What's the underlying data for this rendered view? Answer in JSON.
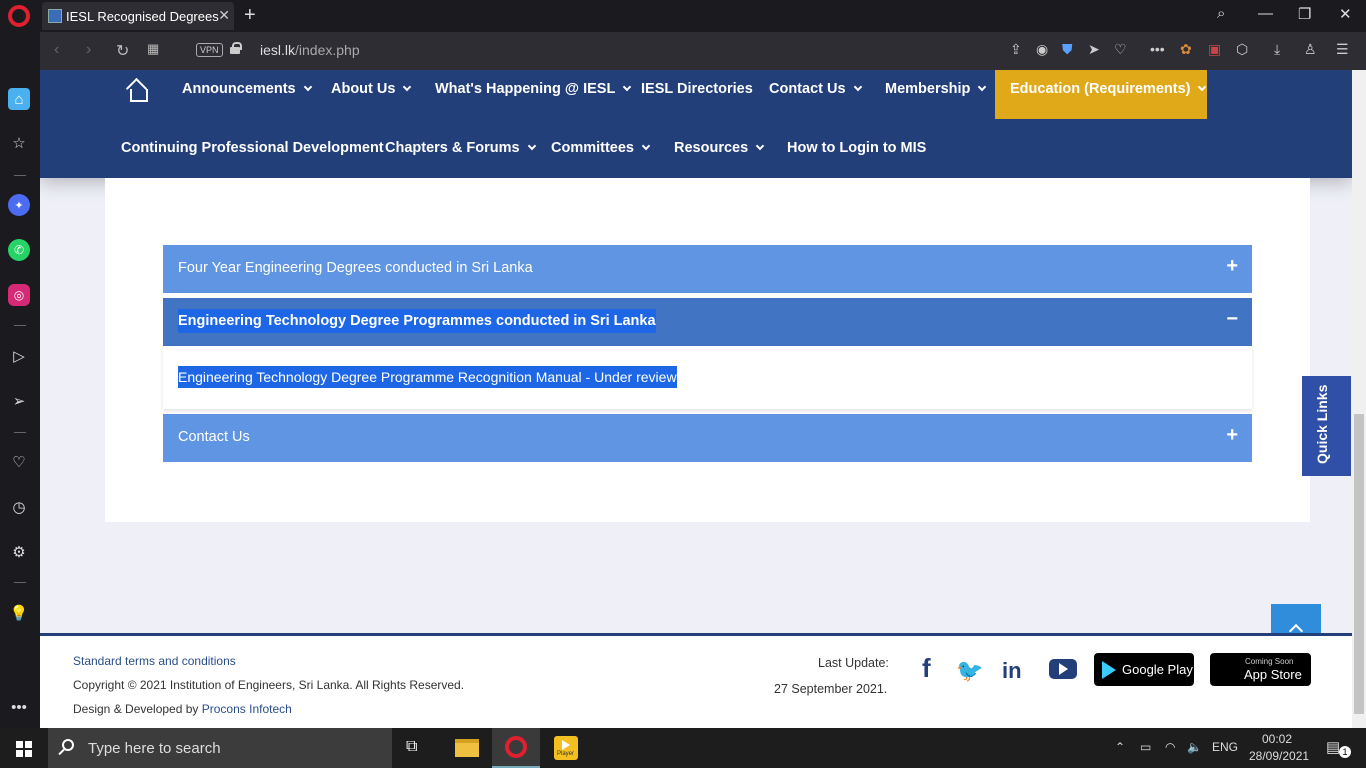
{
  "browser": {
    "tab_title": "IESL Recognised Degrees",
    "url_domain": "iesl.lk",
    "url_path": "/index.php",
    "vpn_label": "VPN"
  },
  "nav": {
    "row1": [
      {
        "label": "Announcements",
        "dropdown": true
      },
      {
        "label": "About Us",
        "dropdown": true
      },
      {
        "label": "What's Happening @ IESL",
        "dropdown": true
      },
      {
        "label": "IESL Directories",
        "dropdown": false
      },
      {
        "label": "Contact Us",
        "dropdown": true
      },
      {
        "label": "Membership",
        "dropdown": true
      },
      {
        "label": "Education (Requirements)",
        "dropdown": true,
        "active": true
      }
    ],
    "row2": [
      {
        "label": "Continuing Professional Development",
        "dropdown": false
      },
      {
        "label": "Chapters & Forums",
        "dropdown": true
      },
      {
        "label": "Committees",
        "dropdown": true
      },
      {
        "label": "Resources",
        "dropdown": true
      },
      {
        "label": "How to Login to MIS",
        "dropdown": false
      }
    ]
  },
  "accordion": [
    {
      "label": "Four Year Engineering Degrees conducted in Sri Lanka",
      "sign": "+",
      "expanded": false
    },
    {
      "label": "Engineering Technology Degree Programmes conducted in Sri Lanka",
      "sign": "−",
      "expanded": true,
      "body_link": "Engineering Technology Degree Programme Recognition Manual - Under review"
    },
    {
      "label": "Contact Us",
      "sign": "+",
      "expanded": false
    }
  ],
  "quick_links": "Quick Links",
  "footer": {
    "terms": "Standard terms and conditions",
    "copyright": "Copyright © 2021 Institution of Engineers, Sri Lanka. All Rights Reserved.",
    "design_prefix": "Design & Developed by ",
    "design_link": "Procons Infotech",
    "last_update_label": "Last Update:",
    "last_update_date": "27 September 2021.",
    "google_play": "Google Play",
    "app_store_small": "Coming Soon",
    "app_store": "App Store"
  },
  "taskbar": {
    "search_placeholder": "Type here to search",
    "lang": "ENG",
    "time": "00:02",
    "date": "28/09/2021",
    "notif_count": "1",
    "player_label": "Player"
  },
  "colors": {
    "nav_bg": "#233f7a",
    "nav_active": "#e0a91a",
    "accordion": "#5f95e2",
    "accordion_active": "#4274c4",
    "selection": "#1d67e6"
  }
}
